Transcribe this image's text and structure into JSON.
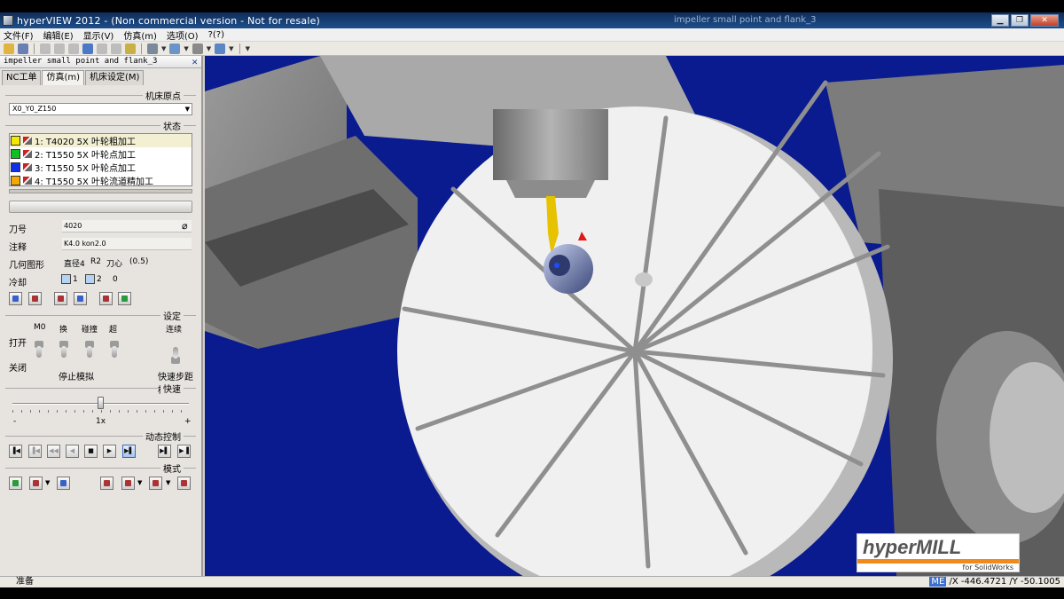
{
  "window": {
    "title": "hyperVIEW 2012 -  (Non commercial version - Not for resale)",
    "center_title": "impeller small point and flank_3"
  },
  "menu": [
    "文件(F)",
    "编辑(E)",
    "显示(V)",
    "仿真(m)",
    "选项(O)",
    "?(?)"
  ],
  "panel": {
    "title": "impeller small point and flank_3",
    "tabs": [
      "NC工单",
      "仿真(m)",
      "机床设定(M)"
    ],
    "origin_header": "机床原点",
    "origin_value": "X0_Y0_Z150",
    "status_header": "状态",
    "jobs": [
      {
        "label": "1: T4020 5X 叶轮粗加工",
        "color": "#f5e800"
      },
      {
        "label": "2: T1550 5X 叶轮点加工",
        "color": "#10c020"
      },
      {
        "label": "3: T1550 5X 叶轮点加工",
        "color": "#1030e8"
      },
      {
        "label": "4: T1550 5X 叶轮流道精加工",
        "color": "#f5a800"
      }
    ],
    "tool_no_label": "刀号",
    "tool_no_value": "4020",
    "comment_label": "注释",
    "comment_value": "K4.0 kon2.0",
    "geometry_label": "几何图形",
    "geometry_diameter": "直径4",
    "geometry_r": "R2",
    "geometry_center_label": "刀心",
    "geometry_center_value": "(0.5)",
    "coolant_label": "冷却",
    "coolant_1": "1",
    "coolant_2": "2",
    "coolant_3": "0",
    "settings_header": "设定",
    "switch_labels": [
      "M0",
      "换",
      "碰撞",
      "超"
    ],
    "continuous_label": "连续",
    "open_label": "打开",
    "close_label": "关闭",
    "stop_sim_label": "停止模拟",
    "rapid_step_label": "快速步距模",
    "speed_header": "快速",
    "speed_minus": "-",
    "speed_value": "1x",
    "speed_plus": "+",
    "speed_fraction": 0.5,
    "motion_header": "动态控制",
    "mode_header": "模式"
  },
  "logo": {
    "main": "hyperMILL",
    "sub": "for SolidWorks"
  },
  "status": {
    "ready": "准备",
    "mode_badge": "ME",
    "coords": "/X    -446.4721 /Y      -50.1005"
  },
  "colors": {
    "viewport_bg": "#0a1a8f",
    "logo_accent": "#f08a1c"
  }
}
